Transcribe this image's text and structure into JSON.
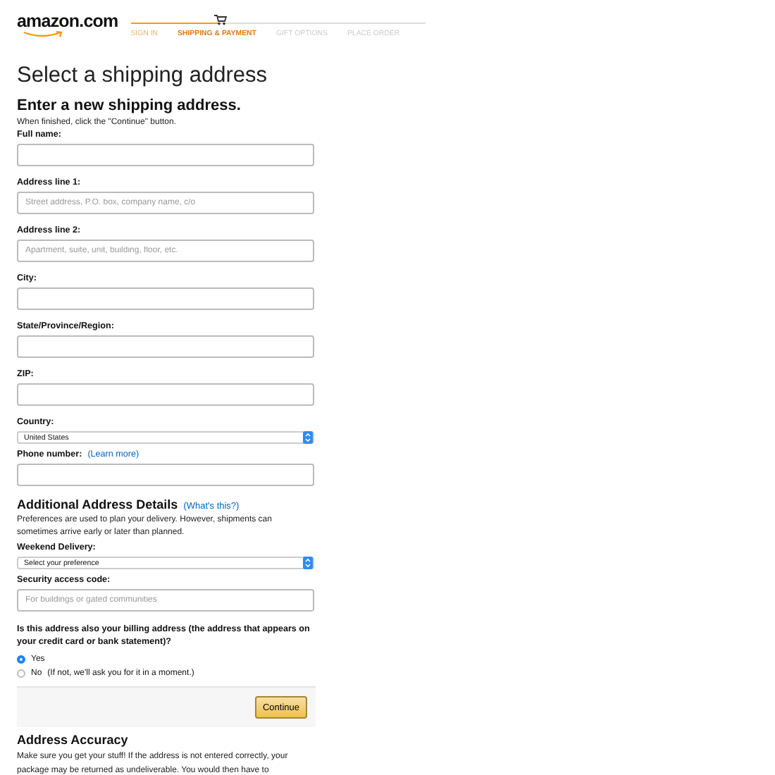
{
  "header": {
    "logo": "amazon.com",
    "steps": [
      {
        "label": "SIGN IN",
        "completed": true,
        "selected": false
      },
      {
        "label": "SHIPPING & PAYMENT",
        "completed": false,
        "selected": true
      },
      {
        "label": "GIFT OPTIONS",
        "completed": false,
        "selected": false
      },
      {
        "label": "PLACE ORDER",
        "completed": false,
        "selected": false
      }
    ]
  },
  "title": "Select a shipping address",
  "form": {
    "heading": "Enter a new shipping address.",
    "hint": "When finished, click the \"Continue\" button.",
    "fields": [
      {
        "kind": "text",
        "label": "Full name:"
      },
      {
        "kind": "text",
        "label": "Address line 1:",
        "placeholder": "Street address, P.O. box, company name, c/o"
      },
      {
        "kind": "text",
        "label": "Address line 2:",
        "placeholder": "Apartment, suite, unit, building, floor, etc."
      },
      {
        "kind": "text",
        "label": "City:"
      },
      {
        "kind": "text",
        "label": "State/Province/Region:"
      },
      {
        "kind": "text",
        "label": "ZIP:"
      },
      {
        "kind": "select",
        "label": "Country:",
        "value": "United States"
      },
      {
        "kind": "text",
        "label": "Phone number:",
        "link": "(Learn more)"
      }
    ]
  },
  "additional": {
    "heading": "Additional Address Details",
    "link": "(What's this?)",
    "text": "Preferences are used to plan your delivery. However, shipments can sometimes arrive early or later than planned.",
    "fields": [
      {
        "kind": "select",
        "label": "Weekend Delivery:",
        "value": "Select your preference"
      },
      {
        "kind": "text",
        "label": "Security access code:",
        "placeholder": "For buildings or gated communities"
      }
    ]
  },
  "billing": {
    "question": "Is this address also your billing address (the address that appears on your credit card or bank statement)?",
    "options": [
      {
        "label": "Yes",
        "selected": true
      },
      {
        "label": "No",
        "note": "(If not, we'll ask you for it in a moment.)",
        "selected": false
      }
    ]
  },
  "continue_button": "Continue",
  "accuracy": {
    "heading": "Address Accuracy",
    "text": "Make sure you get your stuff! If the address is not entered correctly, your package may be returned as undeliverable. You would then have to"
  }
}
